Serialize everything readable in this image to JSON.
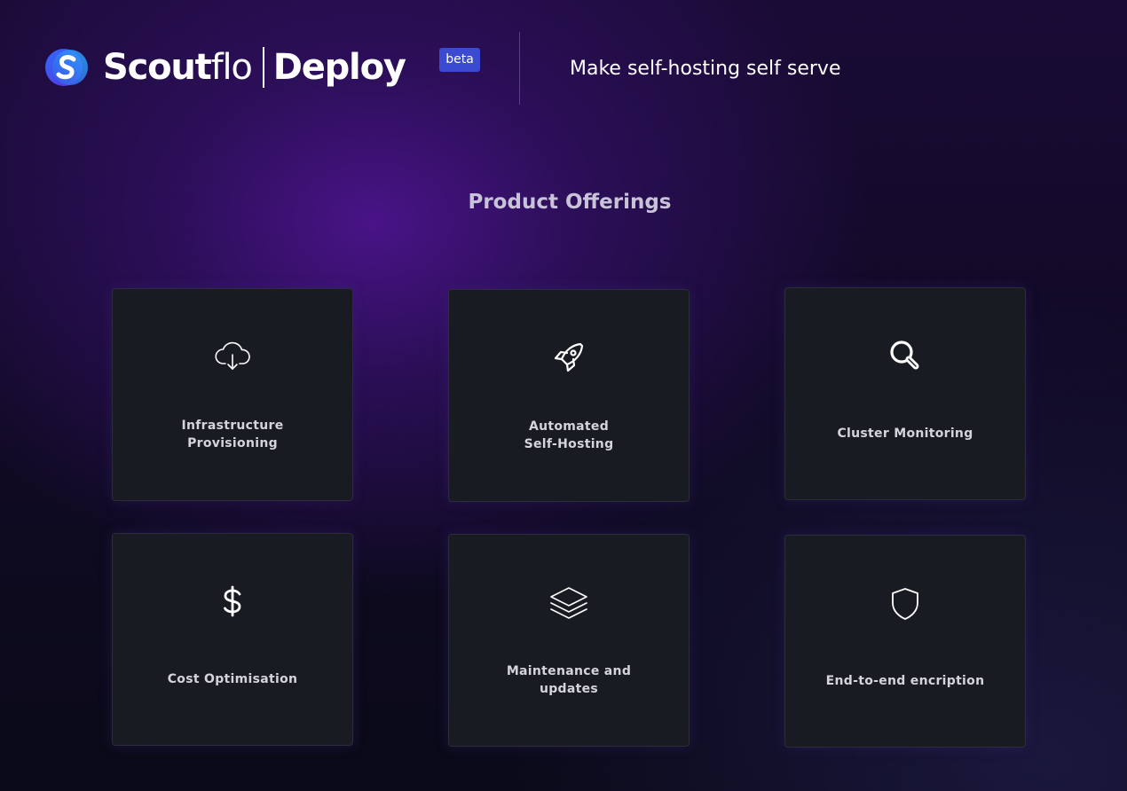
{
  "header": {
    "brand_scout": "Scout",
    "brand_flo": "flo",
    "brand_product": "Deploy",
    "badge": "beta",
    "tagline": "Make self-hosting self serve",
    "logo_icon": "scoutflo-logo-icon"
  },
  "section_title": "Product Offerings",
  "colors": {
    "background_glow": "#4c148c",
    "card_bg": "#181b21",
    "badge_bg": "#3b4bd1",
    "logo_gradient_start": "#2f6bff",
    "logo_gradient_end": "#5b2fd6"
  },
  "offerings": [
    {
      "label": "Infrastructure\nProvisioning",
      "icon": "cloud-download-icon"
    },
    {
      "label": "Automated\nSelf-Hosting",
      "icon": "rocket-icon"
    },
    {
      "label": "Cluster Monitoring",
      "icon": "magnifier-icon"
    },
    {
      "label": "Cost Optimisation",
      "icon": "dollar-icon"
    },
    {
      "label": "Maintenance and\nupdates",
      "icon": "layers-icon"
    },
    {
      "label": "End-to-end encription",
      "icon": "shield-icon"
    }
  ]
}
